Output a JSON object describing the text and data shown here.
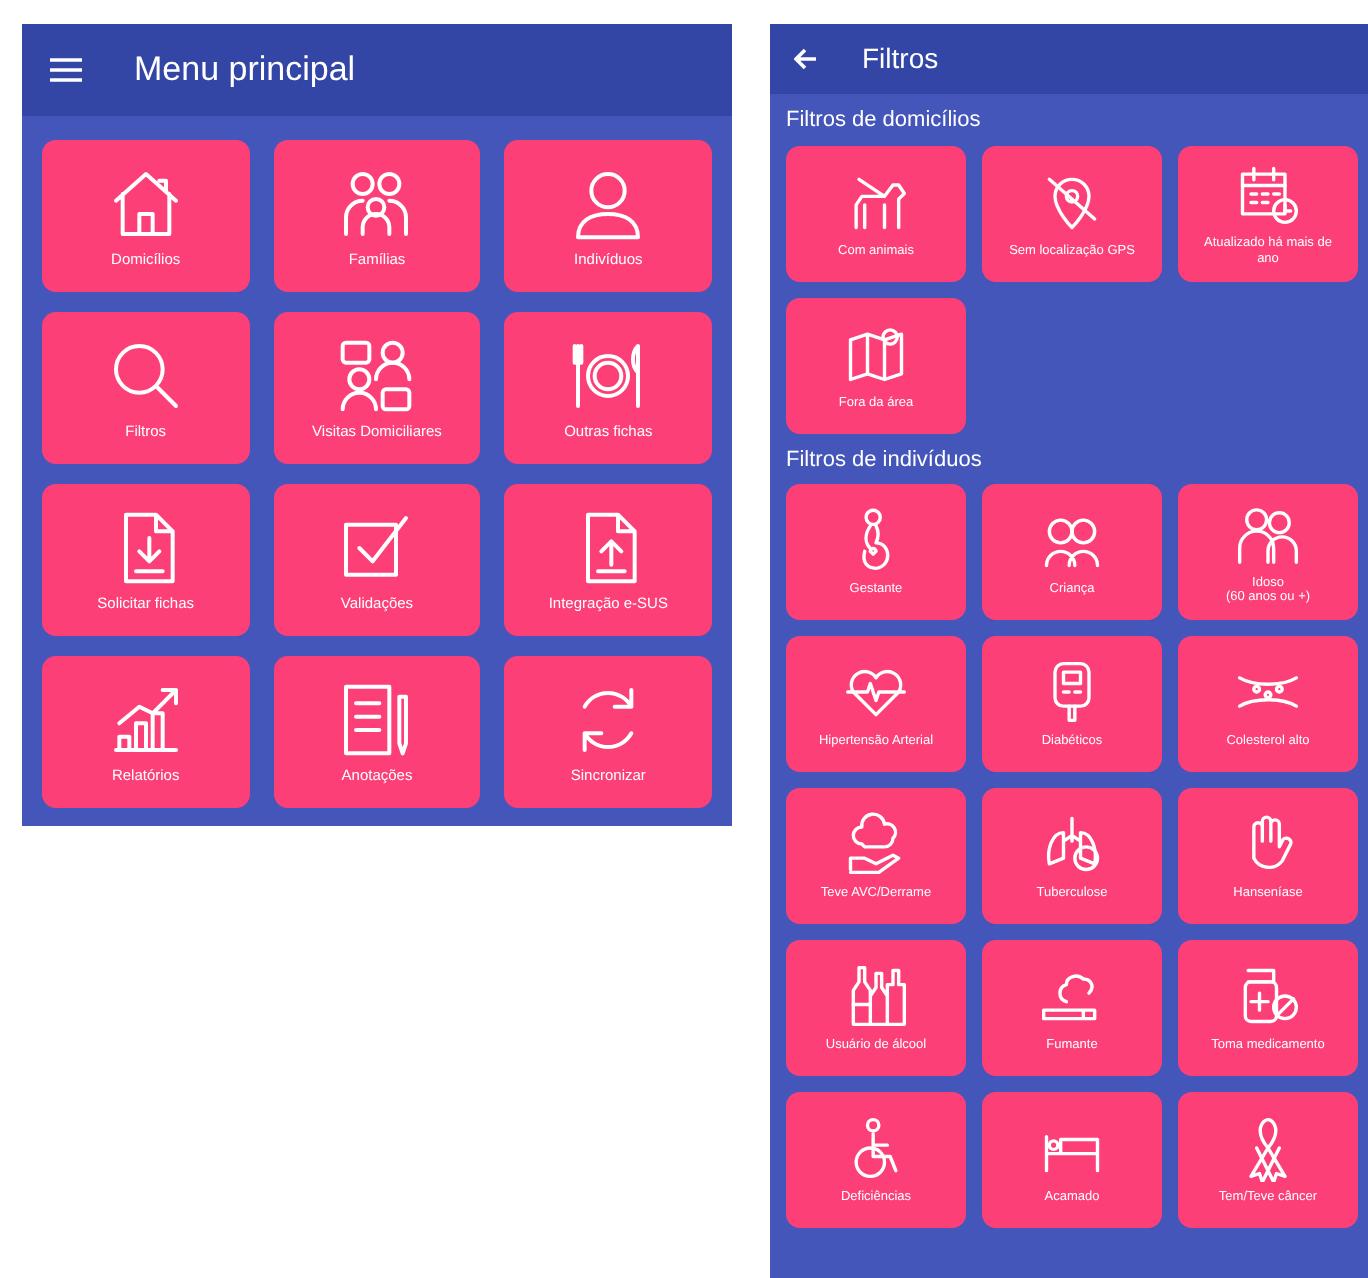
{
  "main_menu": {
    "header": {
      "title": "Menu principal"
    },
    "tiles": [
      {
        "label": "Domicílios"
      },
      {
        "label": "Famílias"
      },
      {
        "label": "Indivíduos"
      },
      {
        "label": "Filtros"
      },
      {
        "label": "Visitas Domiciliares"
      },
      {
        "label": "Outras fichas"
      },
      {
        "label": "Solicitar fichas"
      },
      {
        "label": "Validações"
      },
      {
        "label": "Integração e-SUS"
      },
      {
        "label": "Relatórios"
      },
      {
        "label": "Anotações"
      },
      {
        "label": "Sincronizar"
      }
    ]
  },
  "filters": {
    "header": {
      "title": "Filtros"
    },
    "sections": [
      {
        "title": "Filtros de domicílios",
        "tiles": [
          {
            "label": "Com animais"
          },
          {
            "label": "Sem localização GPS"
          },
          {
            "label": "Atualizado há mais de\nano"
          },
          {
            "label": "Fora da área"
          }
        ]
      },
      {
        "title": "Filtros de indivíduos",
        "tiles": [
          {
            "label": "Gestante"
          },
          {
            "label": "Criança"
          },
          {
            "label": "Idoso\n(60 anos ou +)"
          },
          {
            "label": "Hipertensão Arterial"
          },
          {
            "label": "Diabéticos"
          },
          {
            "label": "Colesterol alto"
          },
          {
            "label": "Teve AVC/Derrame"
          },
          {
            "label": "Tuberculose"
          },
          {
            "label": "Hanseníase"
          },
          {
            "label": "Usuário de álcool"
          },
          {
            "label": "Fumante"
          },
          {
            "label": "Toma medicamento"
          },
          {
            "label": "Deficiências"
          },
          {
            "label": "Acamado"
          },
          {
            "label": "Tem/Teve câncer"
          }
        ]
      }
    ]
  }
}
